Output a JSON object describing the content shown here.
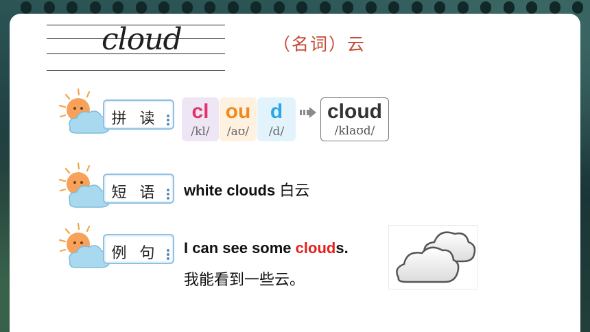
{
  "word": {
    "headword": "cloud",
    "meaning": "（名词）云"
  },
  "labels": {
    "spelling": "拼 读",
    "phrase": "短 语",
    "example": "例 句"
  },
  "phonics": {
    "parts": [
      {
        "letters": "cl",
        "ipa": "/kl/",
        "color": "#e2356b",
        "bg": "#efe6f5"
      },
      {
        "letters": "ou",
        "ipa": "/aʊ/",
        "color": "#f08a1c",
        "bg": "#fff1df"
      },
      {
        "letters": "d",
        "ipa": "/d/",
        "color": "#2aa8e6",
        "bg": "#e3f3fc"
      }
    ],
    "result": {
      "letters": "cloud",
      "ipa": "/klaʊd/"
    }
  },
  "phrase": {
    "en": "white clouds",
    "cn": "白云"
  },
  "example": {
    "before": "I can see some ",
    "highlight": "cloud",
    "after": "s.",
    "translation": "我能看到一些云。"
  },
  "colors": {
    "highlight": "#e3201b",
    "meaning": "#c44a33",
    "label_border": "#8fc0e3"
  }
}
